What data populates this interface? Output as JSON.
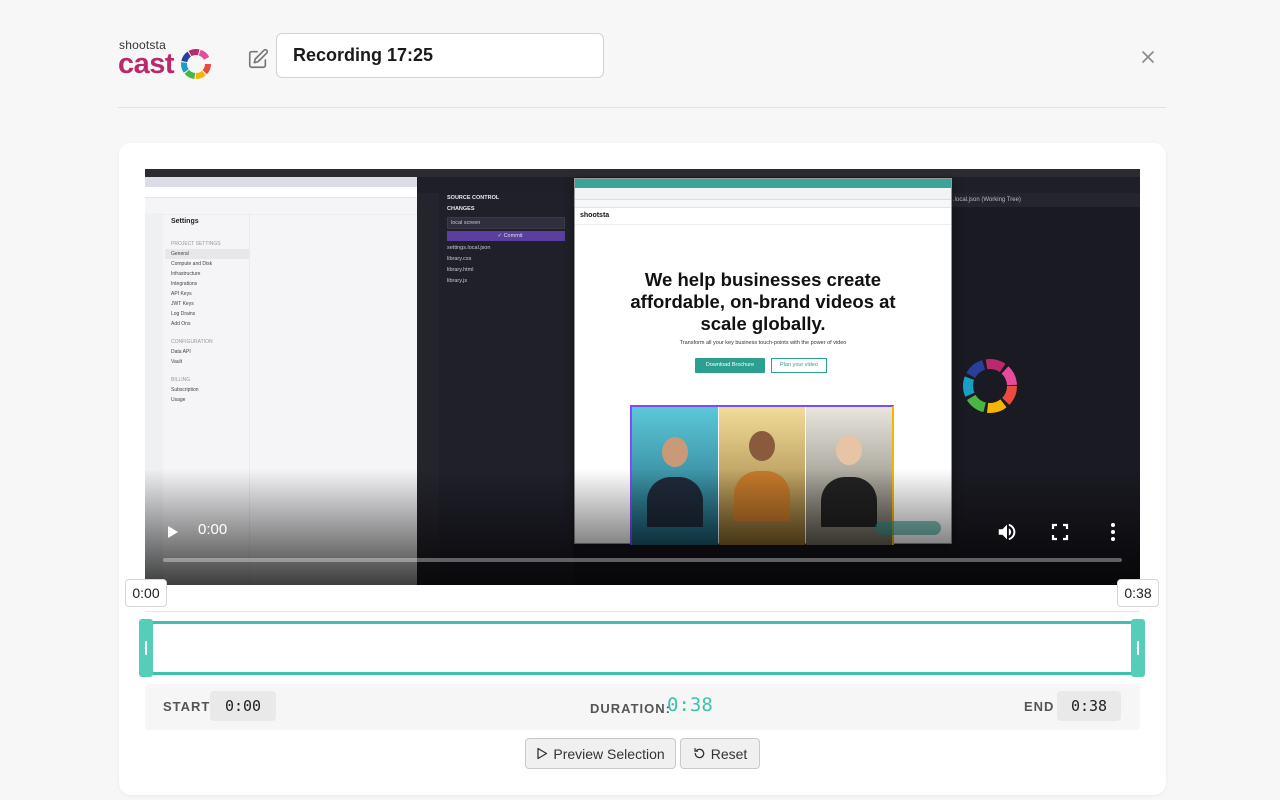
{
  "logo": {
    "top": "shootsta",
    "main": "cast"
  },
  "recording": {
    "title_value": "Recording 17:25"
  },
  "player": {
    "current_time": "0:00",
    "progress": 0
  },
  "screen": {
    "left_app": {
      "heading": "Settings",
      "project_settings": "PROJECT SETTINGS",
      "items": [
        "General",
        "Compute and Disk",
        "Infrastructure",
        "Integrations",
        "API Keys",
        "JWT Keys",
        "Log Drains",
        "Add Ons"
      ],
      "configuration": "CONFIGURATION",
      "config_items": [
        "Data API",
        "Vault"
      ],
      "billing": "BILLING",
      "billing_items": [
        "Subscription",
        "Usage"
      ]
    },
    "editor": {
      "source_control": "SOURCE CONTROL",
      "changes": "CHANGES",
      "message": "local screen",
      "commit": "✓ Commit",
      "files": [
        "settings.local.json",
        "library.css",
        "library.html",
        "library.js"
      ],
      "tab": ".local.json (Working Tree)"
    },
    "site": {
      "brand": "shootsta",
      "headline_1": "We help businesses create",
      "headline_2": "affordable, on-brand videos at",
      "headline_3": "scale globally.",
      "subtitle": "Transform all your key business touch-points with the power of video",
      "btn_primary": "Download Brochure",
      "btn_secondary": "Plan your video"
    }
  },
  "trim": {
    "start_marker": "0:00",
    "end_marker": "0:38",
    "start_label": "START",
    "start_value": "0:00",
    "duration_label": "DURATION:",
    "duration_value": "0:38",
    "end_label": "END",
    "end_value": "0:38"
  },
  "actions": {
    "preview_label": "Preview Selection",
    "reset_label": "Reset"
  },
  "colors": {
    "accent": "#3ec1ac",
    "brand": "#b82a6c"
  }
}
